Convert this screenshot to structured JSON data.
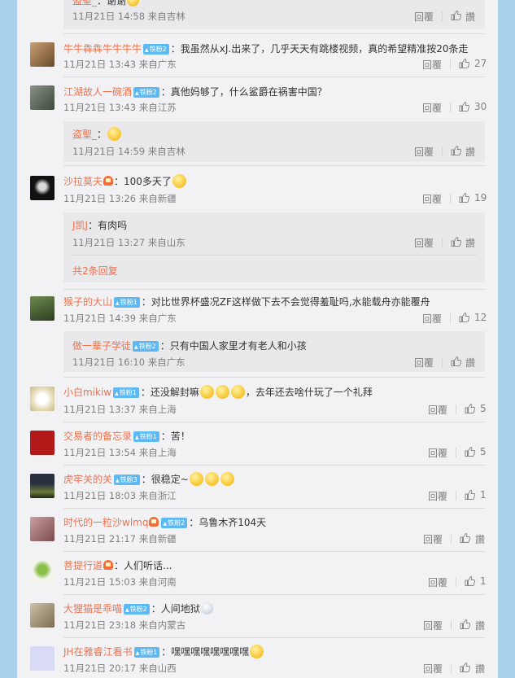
{
  "top_partial": {
    "name": "盗聖_",
    "text": "：谢谢",
    "time": "11月21日 14:58 来自吉林",
    "reply": "回覆",
    "like": "讚"
  },
  "comments": [
    {
      "name": "牛牛犇犇牛牛牛牛",
      "badge": "铁粉2",
      "text": "：我虽然从xJ.出来了，几乎天天有跳楼视频，真的希望精准按20条走",
      "time": "11月21日 13:43 来自广东",
      "reply": "回覆",
      "like": "27"
    },
    {
      "name": "江湖故人一碗酒",
      "badge": "铁粉2",
      "text": "：真他妈够了，什么鲨爵在祸害中国？",
      "time": "11月21日 13:43 来自江苏",
      "reply": "回覆",
      "like": "30",
      "subs": [
        {
          "name": "盗聖_",
          "text": "：",
          "time": "11月21日 14:59 来自吉林",
          "reply": "回覆",
          "like": "讚"
        }
      ]
    },
    {
      "name": "沙拉莫夫",
      "badge": "",
      "text": "：100多天了",
      "time": "11月21日 13:26 来自新疆",
      "reply": "回覆",
      "like": "19",
      "subs": [
        {
          "name": "J凯J",
          "text": "：有肉吗",
          "time": "11月21日 13:27 来自山东",
          "reply": "回覆",
          "like": "讚"
        }
      ],
      "more": "共2条回复"
    },
    {
      "name": "猴子的大山",
      "badge": "铁粉1",
      "text": "：对比世界杯盛况ZF这样做下去不会觉得羞耻吗,水能载舟亦能覆舟",
      "time": "11月21日 14:39 来自广东",
      "reply": "回覆",
      "like": "12",
      "subs": [
        {
          "name": "做一辈子学徒",
          "badge": "铁粉2",
          "text": "：只有中国人家里才有老人和小孩",
          "time": "11月21日 16:10 来自广东",
          "reply": "回覆",
          "like": "讚"
        }
      ]
    },
    {
      "name": "小白mikiw",
      "badge": "铁粉1",
      "text": "：还没解封嘛",
      "text2": "，去年还去啥什玩了一个礼拜",
      "time": "11月21日 13:37 来自上海",
      "reply": "回覆",
      "like": "5"
    },
    {
      "name": "交易者的备忘录",
      "badge": "铁粉1",
      "text": "：苦！",
      "time": "11月21日 13:54 来自上海",
      "reply": "回覆",
      "like": "5"
    },
    {
      "name": "虎牢关的关",
      "badge": "铁粉3",
      "text": "：很稳定~",
      "time": "11月21日 18:03 来自浙江",
      "reply": "回覆",
      "like": "1"
    },
    {
      "name": "时代的一粒沙wlmq",
      "badge": "铁粉2",
      "text": "：乌鲁木齐104天",
      "time": "11月21日 21:17 来自新疆",
      "reply": "回覆",
      "like": "讚"
    },
    {
      "name": "菩提行道",
      "badge": "",
      "text": "：人们听话...",
      "time": "11月21日 15:03 来自河南",
      "reply": "回覆",
      "like": "1"
    },
    {
      "name": "大狸猫是乖喵",
      "badge": "铁粉2",
      "text": "：人间地狱",
      "time": "11月21日 23:18 来自内蒙古",
      "reply": "回覆",
      "like": "讚"
    },
    {
      "name": "JH在雅睿江看书",
      "badge": "铁粉1",
      "text": "：嘿嘿嘿嘿嘿嘿嘿嘿",
      "time": "11月21日 20:17 来自山西",
      "reply": "回覆",
      "like": "讚"
    }
  ]
}
